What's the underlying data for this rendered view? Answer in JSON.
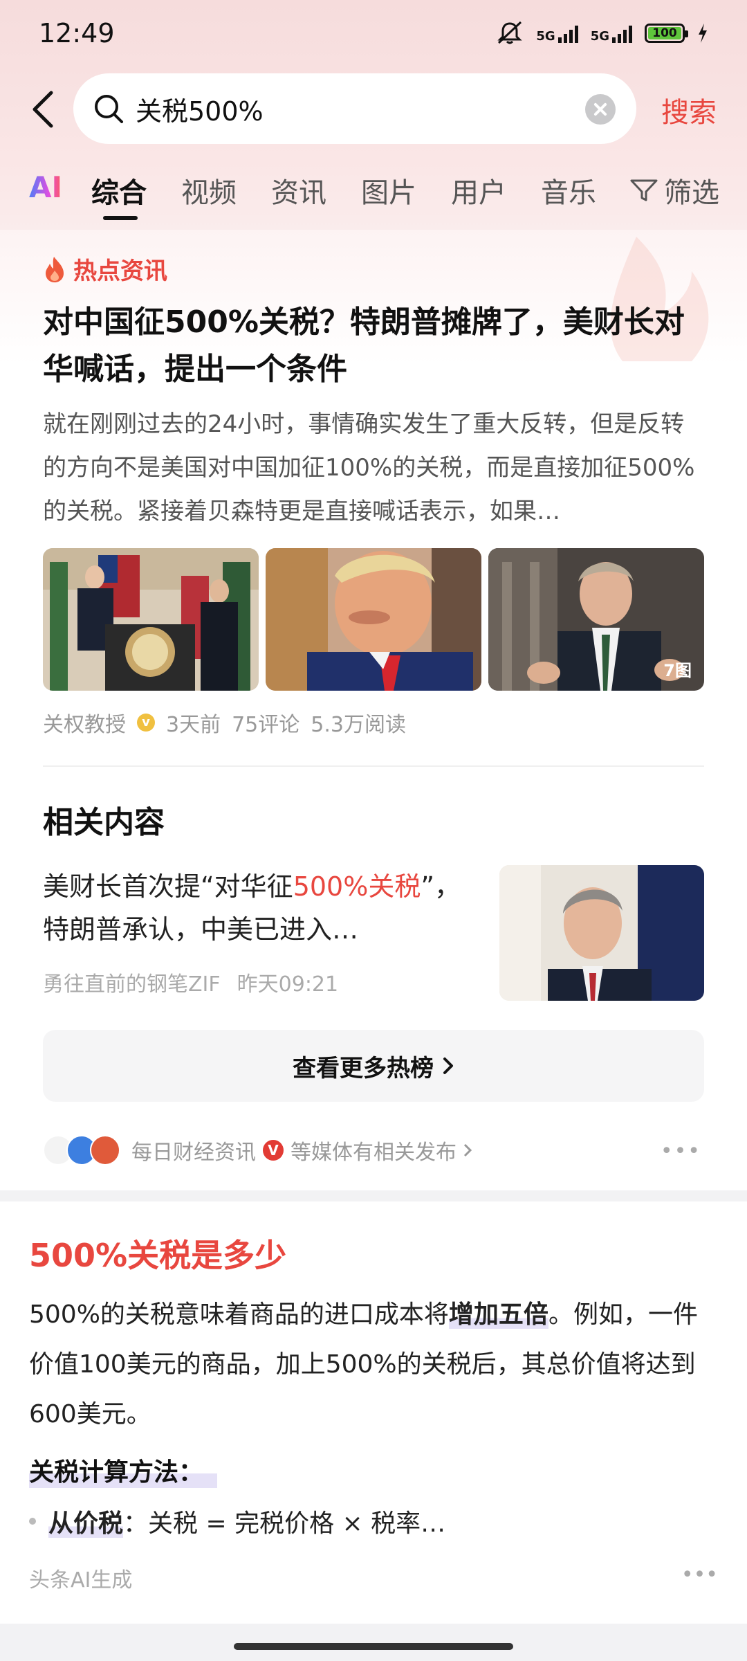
{
  "status_bar": {
    "time": "12:49",
    "battery": "100",
    "net1": "5G",
    "net2": "5G"
  },
  "search": {
    "query": "关税500%",
    "button": "搜索"
  },
  "tabs": [
    "AI",
    "综合",
    "视频",
    "资讯",
    "图片",
    "用户",
    "音乐"
  ],
  "filter_label": "筛选",
  "hot_news": {
    "label": "热点资讯",
    "headline": "对中国征500%关税？特朗普摊牌了，美财长对华喊话，提出一个条件",
    "summary": "就在刚刚过去的24小时，事情确实发生了重大反转，但是反转的方向不是美国对中国加征100%的关税，而是直接加征500%的关税。紧接着贝森特更是直接喊话表示，如果…",
    "image_count": "7图",
    "author": "关权教授",
    "time": "3天前",
    "comments": "75评论",
    "reads": "5.3万阅读"
  },
  "related": {
    "title": "相关内容",
    "text_before": "美财长首次提“对华征",
    "text_highlight": "500%关税",
    "text_after": "”，特朗普承认，中美已进入…",
    "author": "勇往直前的钢笔ZIF",
    "time": "昨天09:21"
  },
  "more_button": "查看更多热榜",
  "sources": {
    "name": "每日财经资讯",
    "suffix": "等媒体有相关发布"
  },
  "ai_answer": {
    "title": "500%关税是多少",
    "para_before": "500%的关税意味着商品的进口成本将",
    "para_highlight": "增加五倍",
    "para_after": "。例如，一件价值100美元的商品，加上500%的关税后，其总价值将达到600美元。",
    "subheading": "关税计算方法：",
    "bullet_term": "从价税",
    "bullet_text": "：关税 = 完税价格 × 税率…",
    "footer": "头条AI生成"
  }
}
